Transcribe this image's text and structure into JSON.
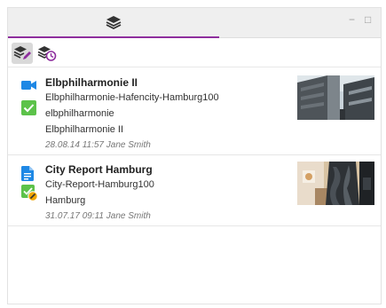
{
  "window": {
    "tab_icon": "layers-icon",
    "minimize_glyph": "−",
    "maximize_glyph": "□"
  },
  "toolbar": {
    "edit_layers_icon": "layers-edit-icon",
    "history_icon": "layers-history-icon"
  },
  "items": [
    {
      "type_icon": "video-icon",
      "status_icon": "checked-icon",
      "title": "Elbphilharmonie II",
      "lines": [
        "Elbphilharmonie-Hafencity-Hamburg100",
        "elbphilharmonie",
        "Elbphilharmonie II"
      ],
      "meta": "28.08.14 11:57 Jane Smith",
      "thumbnail": "building-photo"
    },
    {
      "type_icon": "document-icon",
      "status_icon": "checked-pending-icon",
      "title": "City Report Hamburg",
      "lines": [
        "City-Report-Hamburg100",
        "Hamburg"
      ],
      "meta": "31.07.17 09:11 Jane Smith",
      "thumbnail": "sculpture-photo"
    }
  ],
  "colors": {
    "accent_purple": "#8e2f9e",
    "icon_blue": "#1e88e5",
    "check_green": "#5cc24a",
    "pending_orange": "#f0a500"
  }
}
